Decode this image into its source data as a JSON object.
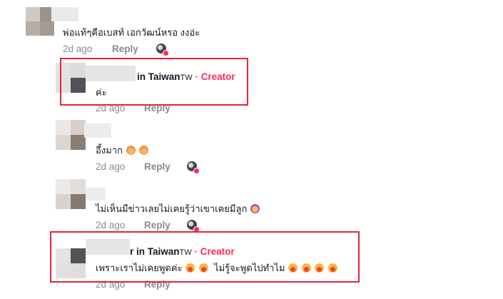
{
  "comments": [
    {
      "text": "พ่อแท้ๆคือเบสท์ เอกวัฒน์หรอ งงอ่ะ",
      "time": "2d ago",
      "reply": "Reply"
    },
    {
      "name_suffix": "in Taiwan",
      "region": "TW",
      "creator": "· Creator",
      "text": "ค่ะ",
      "time": "2d ago",
      "reply": "Reply"
    },
    {
      "text": "อึ้งมาก",
      "time": "2d ago",
      "reply": "Reply"
    },
    {
      "text": "ไม่เห็นมีข่าวเลยไม่เคยรู้ว่าเขาเคยมีลูก",
      "time": "2d ago",
      "reply": "Reply"
    },
    {
      "name_suffix": "r in Taiwan",
      "region": "TW",
      "creator": "· Creator",
      "text": "เพราะเราไม่เคยพูดค่ะ",
      "text2": "ไม่รู้จะพูดไปทำไม",
      "time": "2d ago",
      "reply": "Reply"
    }
  ],
  "icons": {
    "liked_by_creator": "creator-avatar-heart-icon",
    "emoji_teary": "teary-face-icon",
    "emoji_crying": "loudly-crying-face-icon",
    "emoji_laughing": "grinning-sweat-face-icon"
  },
  "colors": {
    "accent": "#fe2c55",
    "highlight": "#e0263a",
    "muted": "#8a8b91"
  }
}
